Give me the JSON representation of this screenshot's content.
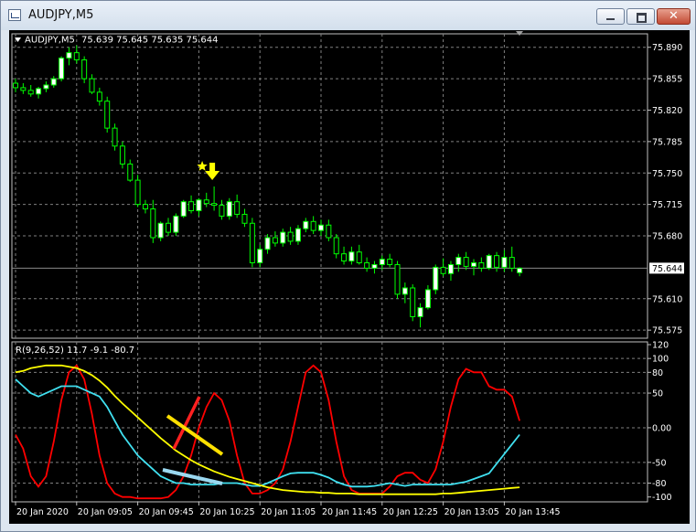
{
  "window": {
    "title": "AUDJPY,M5",
    "close_glyph": "✕"
  },
  "colors": {
    "bull_candle": "#ffffff",
    "bear_candle": "#000000",
    "wick": "#00ff00",
    "grid": "#808080",
    "axis_text": "#ffffff",
    "current_price_bg": "#ffffff",
    "line_red": "#ff0000",
    "line_cyan": "#40e0f0",
    "line_yellow": "#ffff00",
    "signal_arrow": "#ffff00"
  },
  "chart_data": [
    {
      "type": "candlestick",
      "symbol_label": "AUDJPY,M5",
      "ohlc_label": "75.639 75.645 75.635 75.644",
      "current_price": "75.644",
      "y_ticks": [
        "75.890",
        "75.855",
        "75.820",
        "75.785",
        "75.750",
        "75.715",
        "75.680",
        "75.610",
        "75.575"
      ],
      "ylim": [
        75.566,
        75.905
      ],
      "x_ticks": [
        "20 Jan 2020",
        "20 Jan 09:05",
        "20 Jan 09:45",
        "20 Jan 10:25",
        "20 Jan 11:05",
        "20 Jan 11:45",
        "20 Jan 12:25",
        "20 Jan 13:05",
        "20 Jan 13:45"
      ],
      "signals": [
        {
          "type": "sell-arrow",
          "bar_index": 26
        }
      ],
      "candles": [
        [
          75.85,
          75.855,
          75.84,
          75.845
        ],
        [
          75.845,
          75.85,
          75.838,
          75.842
        ],
        [
          75.842,
          75.848,
          75.835,
          75.838
        ],
        [
          75.838,
          75.846,
          75.833,
          75.844
        ],
        [
          75.844,
          75.852,
          75.84,
          75.848
        ],
        [
          75.848,
          75.858,
          75.845,
          75.855
        ],
        [
          75.855,
          75.88,
          75.852,
          75.878
        ],
        [
          75.878,
          75.89,
          75.87,
          75.884
        ],
        [
          75.884,
          75.892,
          75.872,
          75.876
        ],
        [
          75.876,
          75.88,
          75.85,
          75.855
        ],
        [
          75.855,
          75.86,
          75.838,
          75.84
        ],
        [
          75.84,
          75.845,
          75.825,
          75.83
        ],
        [
          75.83,
          75.835,
          75.795,
          75.8
        ],
        [
          75.8,
          75.805,
          75.775,
          75.78
        ],
        [
          75.78,
          75.785,
          75.755,
          75.76
        ],
        [
          75.76,
          75.765,
          75.74,
          75.742
        ],
        [
          75.742,
          75.748,
          75.712,
          75.715
        ],
        [
          75.715,
          75.72,
          75.705,
          75.71
        ],
        [
          75.71,
          75.72,
          75.672,
          75.678
        ],
        [
          75.678,
          75.696,
          75.674,
          75.694
        ],
        [
          75.694,
          75.7,
          75.68,
          75.684
        ],
        [
          75.684,
          75.705,
          75.68,
          75.702
        ],
        [
          75.702,
          75.72,
          75.7,
          75.718
        ],
        [
          75.718,
          75.725,
          75.705,
          75.708
        ],
        [
          75.708,
          75.722,
          75.702,
          75.72
        ],
        [
          75.72,
          75.728,
          75.712,
          75.716
        ],
        [
          75.716,
          75.735,
          75.708,
          75.714
        ],
        [
          75.714,
          75.72,
          75.698,
          75.702
        ],
        [
          75.702,
          75.722,
          75.698,
          75.718
        ],
        [
          75.718,
          75.726,
          75.7,
          75.704
        ],
        [
          75.704,
          75.71,
          75.69,
          75.694
        ],
        [
          75.694,
          75.7,
          75.645,
          75.65
        ],
        [
          75.65,
          75.67,
          75.645,
          75.665
        ],
        [
          75.665,
          75.682,
          75.66,
          75.678
        ],
        [
          75.678,
          75.685,
          75.668,
          75.672
        ],
        [
          75.672,
          75.688,
          75.668,
          75.684
        ],
        [
          75.684,
          75.69,
          75.67,
          75.674
        ],
        [
          75.674,
          75.692,
          75.67,
          75.688
        ],
        [
          75.688,
          75.7,
          75.684,
          75.696
        ],
        [
          75.696,
          75.702,
          75.682,
          75.686
        ],
        [
          75.686,
          75.698,
          75.68,
          75.692
        ],
        [
          75.692,
          75.698,
          75.674,
          75.678
        ],
        [
          75.678,
          75.682,
          75.655,
          75.66
        ],
        [
          75.66,
          75.668,
          75.648,
          75.652
        ],
        [
          75.652,
          75.668,
          75.648,
          75.662
        ],
        [
          75.662,
          75.67,
          75.648,
          75.65
        ],
        [
          75.65,
          75.656,
          75.64,
          75.644
        ],
        [
          75.644,
          75.652,
          75.638,
          75.648
        ],
        [
          75.648,
          75.658,
          75.642,
          75.654
        ],
        [
          75.654,
          75.66,
          75.645,
          75.648
        ],
        [
          75.648,
          75.652,
          75.61,
          75.615
        ],
        [
          75.615,
          75.628,
          75.605,
          75.622
        ],
        [
          75.622,
          75.626,
          75.585,
          75.59
        ],
        [
          75.59,
          75.605,
          75.578,
          75.6
        ],
        [
          75.6,
          75.625,
          75.598,
          75.62
        ],
        [
          75.62,
          75.648,
          75.615,
          75.645
        ],
        [
          75.645,
          75.655,
          75.635,
          75.638
        ],
        [
          75.638,
          75.652,
          75.63,
          75.648
        ],
        [
          75.648,
          75.66,
          75.64,
          75.656
        ],
        [
          75.656,
          75.662,
          75.642,
          75.646
        ],
        [
          75.646,
          75.654,
          75.636,
          75.65
        ],
        [
          75.65,
          75.656,
          75.64,
          75.644
        ],
        [
          75.644,
          75.66,
          75.642,
          75.658
        ],
        [
          75.658,
          75.662,
          75.64,
          75.645
        ],
        [
          75.645,
          75.664,
          75.64,
          75.656
        ],
        [
          75.656,
          75.668,
          75.64,
          75.644
        ],
        [
          75.639,
          75.645,
          75.635,
          75.644
        ]
      ]
    },
    {
      "type": "line",
      "indicator_label": "R(9,26,52) 11.7 -9.1 -80.7",
      "y_ticks": [
        "120",
        "100",
        "80",
        "50",
        "0.00",
        "-50",
        "-80",
        "-100"
      ],
      "ylim": [
        -107,
        124
      ],
      "series": [
        {
          "color_key": "line_red",
          "values": [
            -10,
            -30,
            -70,
            -85,
            -70,
            -20,
            40,
            80,
            90,
            70,
            20,
            -40,
            -80,
            -95,
            -100,
            -100,
            -102,
            -102,
            -102,
            -102,
            -100,
            -90,
            -70,
            -40,
            0,
            30,
            50,
            40,
            10,
            -40,
            -80,
            -95,
            -95,
            -90,
            -80,
            -60,
            -20,
            30,
            80,
            90,
            80,
            40,
            -20,
            -70,
            -90,
            -95,
            -95,
            -95,
            -95,
            -85,
            -70,
            -65,
            -65,
            -75,
            -80,
            -60,
            -20,
            30,
            70,
            85,
            80,
            80,
            60,
            55,
            55,
            45,
            10
          ]
        },
        {
          "color_key": "line_cyan",
          "values": [
            70,
            60,
            50,
            45,
            50,
            55,
            60,
            60,
            60,
            55,
            50,
            45,
            30,
            10,
            -10,
            -25,
            -40,
            -50,
            -60,
            -70,
            -75,
            -80,
            -80,
            -82,
            -82,
            -82,
            -82,
            -80,
            -80,
            -80,
            -82,
            -84,
            -84,
            -80,
            -75,
            -70,
            -66,
            -65,
            -65,
            -65,
            -68,
            -72,
            -78,
            -82,
            -85,
            -85,
            -85,
            -84,
            -82,
            -80,
            -82,
            -84,
            -82,
            -82,
            -82,
            -82,
            -82,
            -82,
            -80,
            -78,
            -74,
            -70,
            -66,
            -52,
            -38,
            -24,
            -10
          ]
        },
        {
          "color_key": "line_yellow",
          "values": [
            80,
            82,
            86,
            88,
            90,
            90,
            90,
            88,
            86,
            82,
            76,
            68,
            58,
            46,
            35,
            25,
            15,
            5,
            -5,
            -15,
            -24,
            -33,
            -40,
            -47,
            -53,
            -58,
            -63,
            -67,
            -71,
            -74,
            -77,
            -80,
            -83,
            -86,
            -88,
            -90,
            -91,
            -92,
            -93,
            -93,
            -94,
            -94,
            -95,
            -95,
            -95,
            -96,
            -96,
            -96,
            -96,
            -96,
            -96,
            -96,
            -96,
            -96,
            -96,
            -96,
            -95,
            -95,
            -94,
            -93,
            -92,
            -91,
            -90,
            -89,
            -88,
            -87,
            -86
          ]
        }
      ],
      "annotations": [
        {
          "type": "segment",
          "color": "#ff2020"
        },
        {
          "type": "segment",
          "color": "#ffe000"
        },
        {
          "type": "segment",
          "color": "#9ad8f0"
        }
      ]
    }
  ]
}
